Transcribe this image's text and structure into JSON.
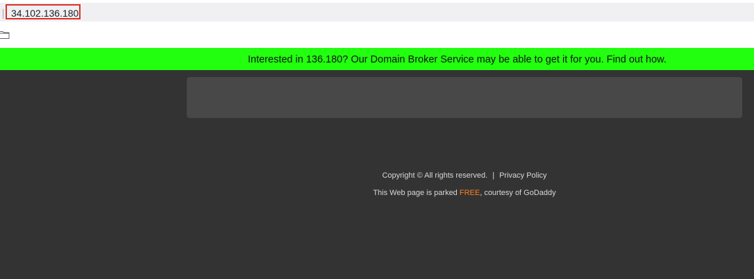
{
  "browser": {
    "url": "34.102.136.180"
  },
  "banner": {
    "text": "Interested in 136.180? Our Domain Broker Service may be able to get it for you. Find out how."
  },
  "footer": {
    "copyright": "Copyright ©  All rights reserved.",
    "separator": "|",
    "privacy_label": "Privacy Policy",
    "parked_prefix": "This Web page is parked ",
    "free_label": "FREE",
    "parked_suffix": ", courtesy of GoDaddy"
  },
  "colors": {
    "banner_bg": "#22ff0f",
    "page_bg": "#333333",
    "panel_bg": "#484848",
    "free_link": "#ff7f1f",
    "url_highlight_border": "#d93025"
  },
  "icons": {
    "bookmark_folder": "folder-icon"
  }
}
